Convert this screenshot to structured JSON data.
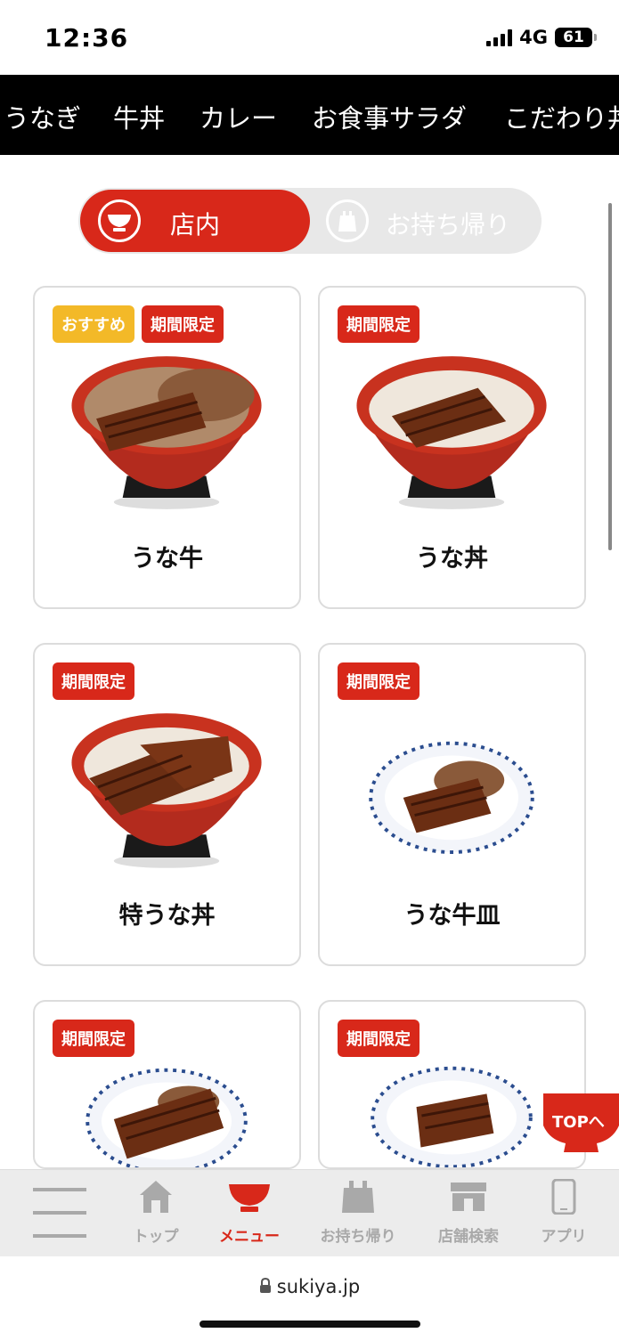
{
  "status": {
    "time": "12:36",
    "network": "4G",
    "battery": "61"
  },
  "category_nav": {
    "items": [
      "うなぎ",
      "牛丼",
      "カレー",
      "お食事サラダ",
      "こだわり丼"
    ]
  },
  "toggle": {
    "active_label": "店内",
    "inactive_label": "お持ち帰り"
  },
  "menu_items": [
    {
      "name": "うな牛",
      "badges": [
        "おすすめ",
        "期間限定"
      ]
    },
    {
      "name": "うな丼",
      "badges": [
        "期間限定"
      ]
    },
    {
      "name": "特うな丼",
      "badges": [
        "期間限定"
      ]
    },
    {
      "name": "うな牛皿",
      "badges": [
        "期間限定"
      ]
    },
    {
      "name": "",
      "badges": [
        "期間限定"
      ]
    },
    {
      "name": "",
      "badges": [
        "期間限定"
      ]
    }
  ],
  "top_button": {
    "label": "TOPへ"
  },
  "tabbar": {
    "items": [
      {
        "label": "",
        "icon": "menu-lines-icon"
      },
      {
        "label": "トップ",
        "icon": "home-icon"
      },
      {
        "label": "メニュー",
        "icon": "bowl-icon"
      },
      {
        "label": "お持ち帰り",
        "icon": "bag-icon"
      },
      {
        "label": "店舗検索",
        "icon": "store-icon"
      },
      {
        "label": "アプリ",
        "icon": "phone-icon"
      }
    ]
  },
  "browser": {
    "url": "sukiya.jp"
  },
  "colors": {
    "brand_red": "#d8281a",
    "badge_yellow": "#f3b928",
    "nav_bg": "#000000"
  }
}
